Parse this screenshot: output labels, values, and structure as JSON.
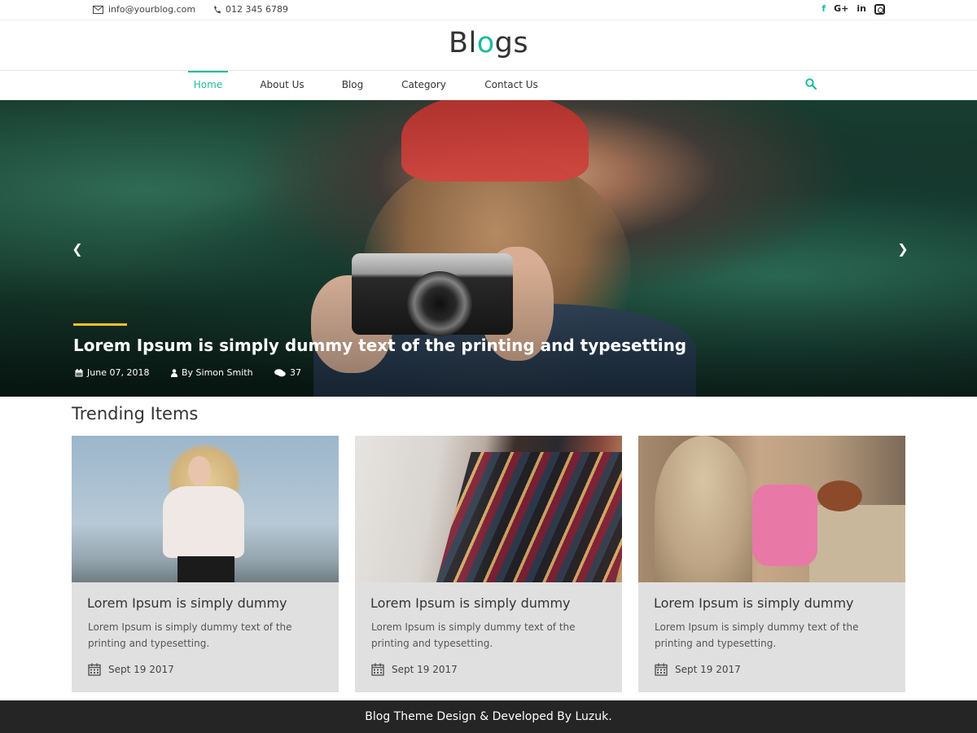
{
  "topbar": {
    "email": "info@yourblog.com",
    "phone": "012 345 6789",
    "socials": [
      "f",
      "G+",
      "in"
    ]
  },
  "logo": {
    "prefix": "Bl",
    "highlight": "o",
    "suffix": "gs"
  },
  "nav": {
    "items": [
      {
        "label": "Home"
      },
      {
        "label": "About Us"
      },
      {
        "label": "Blog"
      },
      {
        "label": "Category"
      },
      {
        "label": "Contact Us"
      }
    ]
  },
  "hero": {
    "title": "Lorem Ipsum is simply dummy text of the printing and typesetting",
    "date": "June 07, 2018",
    "author": "By Simon Smith",
    "comments": "37"
  },
  "trending": {
    "title": "Trending Items",
    "cards": [
      {
        "title": "Lorem Ipsum is simply dummy",
        "text": "Lorem Ipsum is simply dummy text of the printing and typesetting.",
        "date": "Sept 19 2017"
      },
      {
        "title": "Lorem Ipsum is simply dummy",
        "text": "Lorem Ipsum is simply dummy text of the printing and typesetting.",
        "date": "Sept 19 2017"
      },
      {
        "title": "Lorem Ipsum is simply dummy",
        "text": "Lorem Ipsum is simply dummy text of the printing and typesetting.",
        "date": "Sept 19 2017"
      }
    ]
  },
  "footer": {
    "text": "Blog Theme Design & Developed By Luzuk."
  },
  "colors": {
    "accent": "#1abc9c",
    "hero_line": "#f2c230",
    "footer_bg": "#252525",
    "card_bg": "#e0e0e0"
  },
  "icons": [
    "envelope-icon",
    "phone-icon",
    "facebook-icon",
    "google-plus-icon",
    "linkedin-icon",
    "instagram-icon",
    "search-icon",
    "chevron-left-icon",
    "chevron-right-icon",
    "calendar-icon",
    "user-icon",
    "comments-icon"
  ]
}
